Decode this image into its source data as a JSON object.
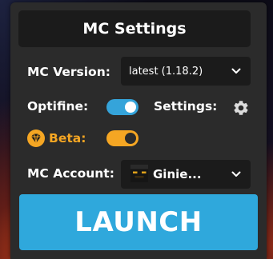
{
  "header": {
    "title": "MC Settings"
  },
  "version": {
    "label": "MC Version:",
    "selected": "latest (1.18.2)"
  },
  "optifine": {
    "label": "Optifine:",
    "enabled": true,
    "color": "#35a4da"
  },
  "settings": {
    "label": "Settings:",
    "icon": "gear-icon"
  },
  "beta": {
    "label": "Beta:",
    "enabled": true,
    "color": "#f5a623",
    "icon": "diamond-icon"
  },
  "account": {
    "label": "MC Account:",
    "selected": "Ginie...",
    "icon": "player-head-icon"
  },
  "launch": {
    "label": "LAUNCH",
    "color": "#2fa8dc"
  }
}
